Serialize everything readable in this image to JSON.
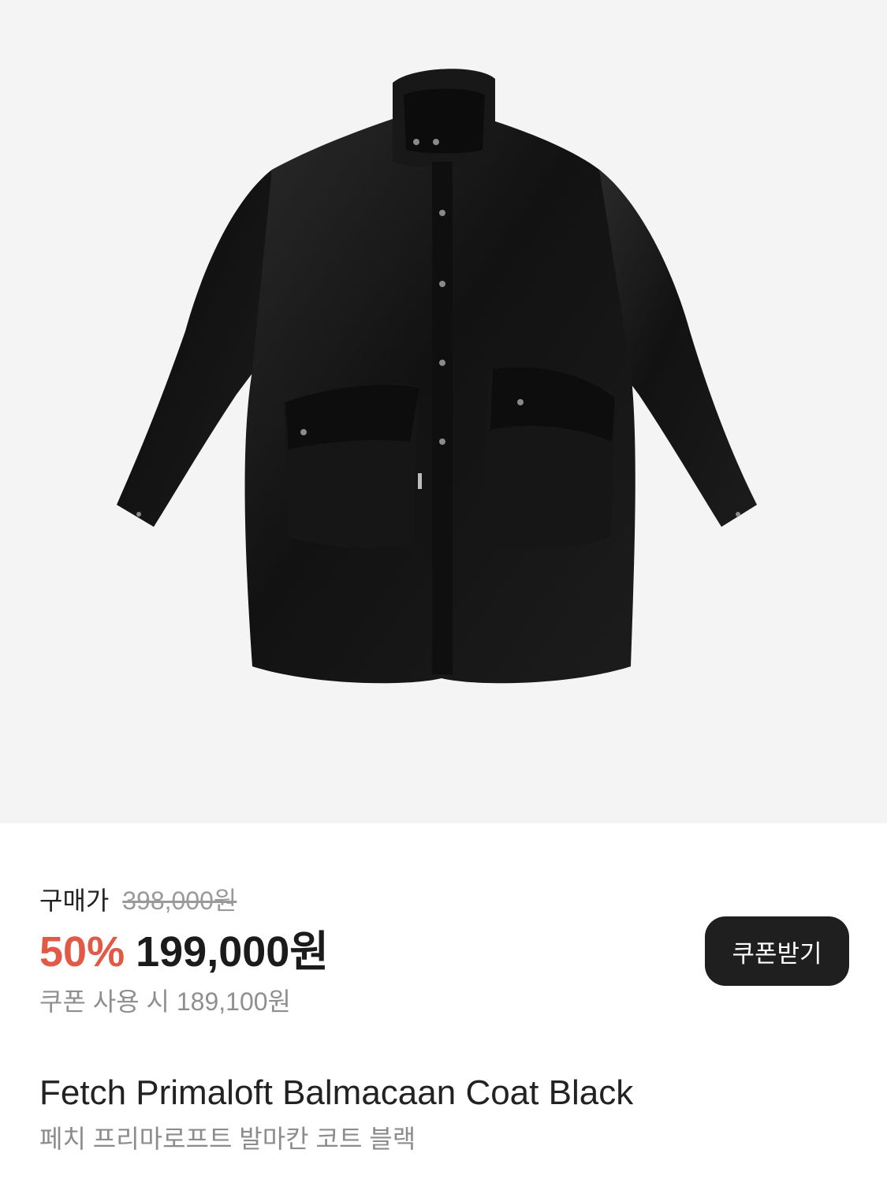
{
  "product": {
    "image_alt": "Fetch Primaloft Balmacaan Coat Black",
    "image_bg": "#f4f4f4",
    "coat_color": "#141414"
  },
  "pricing": {
    "purchase_label": "구매가",
    "original_price": "398,000원",
    "discount_rate": "50%",
    "sale_price": "199,000원",
    "coupon_price_text": "쿠폰 사용 시 189,100원",
    "discount_color": "#e05a47"
  },
  "coupon_button": {
    "label": "쿠폰받기"
  },
  "title": {
    "english": "Fetch Primaloft Balmacaan Coat Black",
    "korean": "페치 프리마로프트 발마칸 코트 블랙"
  }
}
